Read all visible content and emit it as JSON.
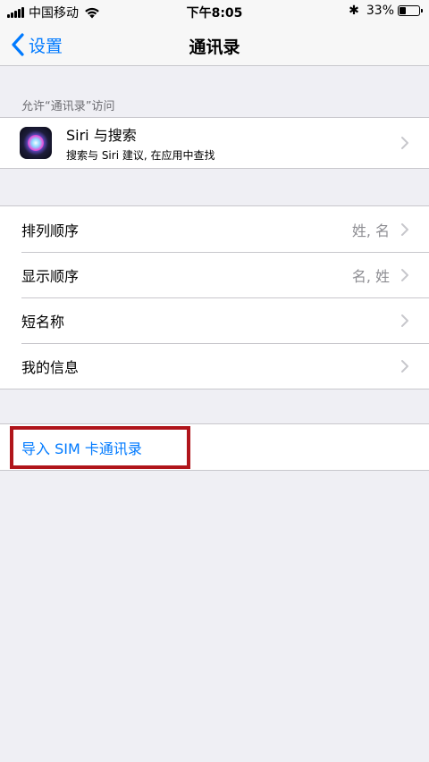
{
  "status_bar": {
    "carrier": "中国移动",
    "time": "下午8:05",
    "battery_percent": "33%",
    "battery_level": 0.33
  },
  "nav": {
    "back_label": "设置",
    "title": "通讯录"
  },
  "siri_section": {
    "header": "允许“通讯录”访问",
    "title": "Siri 与搜索",
    "subtitle": "搜索与 Siri 建议, 在应用中查找"
  },
  "settings": {
    "rows": [
      {
        "label": "排列顺序",
        "value": "姓, 名"
      },
      {
        "label": "显示顺序",
        "value": "名, 姓"
      },
      {
        "label": "短名称",
        "value": ""
      },
      {
        "label": "我的信息",
        "value": ""
      }
    ]
  },
  "import": {
    "label": "导入 SIM 卡通讯录"
  },
  "colors": {
    "accent": "#007aff",
    "highlight": "#b0151b",
    "background": "#efeff4"
  }
}
